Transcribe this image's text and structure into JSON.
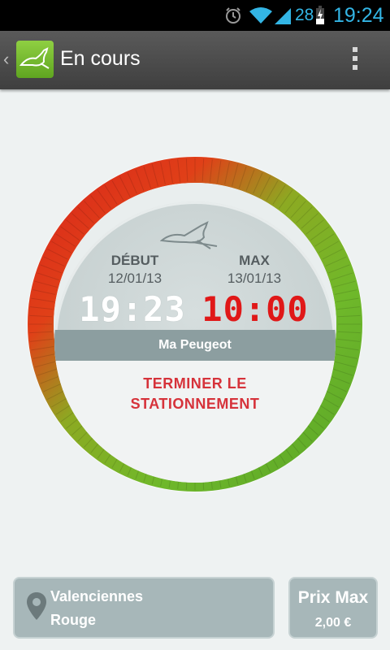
{
  "status_bar": {
    "battery_level": "28",
    "time": "19:24",
    "icons": [
      "alarm-icon",
      "wifi-icon",
      "signal-icon",
      "battery-charging-icon"
    ],
    "text_color": "#33b5e5"
  },
  "action_bar": {
    "title": "En cours",
    "logo_icon": "kangaroo-logo",
    "menu_icon": "overflow-menu-icon"
  },
  "parking": {
    "start_label": "DÉBUT",
    "start_date": "12/01/13",
    "start_time": "19:23",
    "max_label": "MAX",
    "max_date": "13/01/13",
    "max_time": "10:00",
    "vehicle": "Ma Peugeot",
    "end_button_line1": "TERMINER LE",
    "end_button_line2": "STATIONNEMENT",
    "progress_fraction": 0.02
  },
  "location": {
    "city": "Valenciennes",
    "zone": "Rouge",
    "icon": "map-pin-icon"
  },
  "price": {
    "label": "Prix Max",
    "value": "2,00 €"
  },
  "colors": {
    "accent_green": "#6fb82a",
    "accent_red": "#e01818",
    "end_button_text": "#d6323a",
    "card_bg": "#a7b7b9"
  }
}
